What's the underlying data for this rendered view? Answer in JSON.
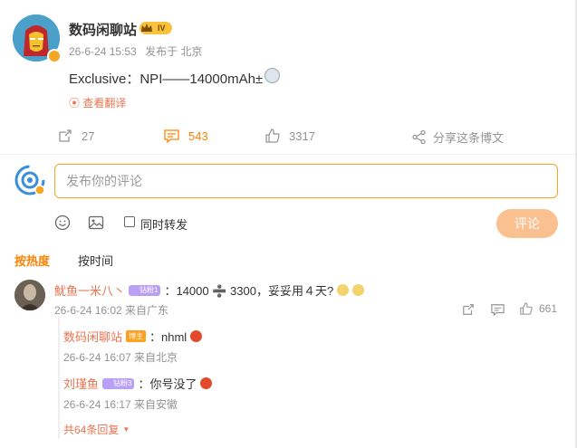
{
  "post": {
    "author": "数码闲聊站",
    "level": "IV",
    "timestamp": "26-6-24 15:53",
    "source": "发布于 北京",
    "content": "Exclusive：NPI——14000mAh±",
    "translate_label": "查看翻译",
    "actions": {
      "repost_count": "27",
      "comment_count": "543",
      "like_count": "3317",
      "share_label": "分享这条博文"
    }
  },
  "composer": {
    "placeholder": "发布你的评论",
    "repost_checkbox_label": "同时转发",
    "submit_label": "评论"
  },
  "sort_tabs": {
    "hot": "按热度",
    "time": "按时间"
  },
  "comments": [
    {
      "user": "魷鱼一米八丶",
      "badge": "钻粉1",
      "text": "：14000 ➗ 3300，妥妥用４天?",
      "time": "26-6-24 16:02 来自广东",
      "like_count": "661",
      "replies": [
        {
          "user": "数码闲聊站",
          "badge": "博主",
          "text": "：nhml",
          "time": "26-6-24 16:07 来自北京"
        },
        {
          "user": "刘瑾鱼",
          "badge": "钻粉3",
          "text": "：你号没了",
          "time": "26-6-24 16:17 来自安徽"
        }
      ],
      "more_replies": "共64条回复"
    }
  ],
  "colors": {
    "accent": "#ff8200",
    "link": "#eb7350",
    "muted": "#939393",
    "input_border": "#f5a623",
    "button_disabled": "#fac08f"
  }
}
